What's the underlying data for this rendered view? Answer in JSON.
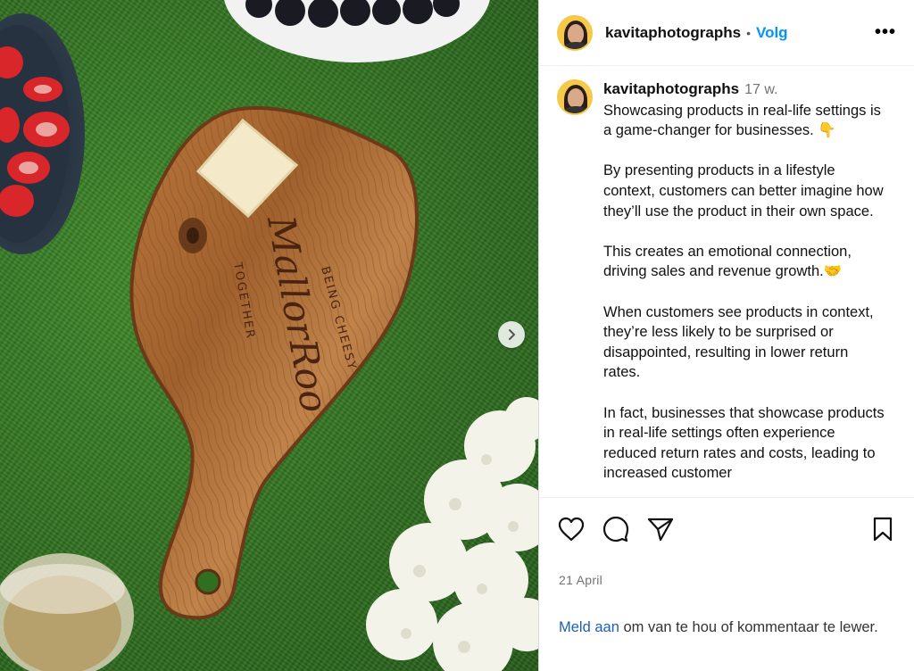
{
  "post": {
    "username": "kavitaphotographs",
    "separator": "•",
    "follow_label": "Volg",
    "more_label": "•••",
    "caption_username": "kavitaphotographs",
    "caption_time": "17 w.",
    "caption_text": "Showcasing products in real-life settings is a game-changer for businesses. 👇\n\nBy presenting products in a lifestyle context, customers can better imagine how they’ll use the product in their own space.\n\nThis creates an emotional connection, driving sales and revenue growth.🤝\n\nWhen customers see products in context, they’re less likely to be surprised or disappointed, resulting in lower return rates.\n\nIn fact, businesses that showcase products in real-life settings often experience reduced return rates and costs, leading to increased customer",
    "date": "21 April",
    "login_link": "Meld aan",
    "login_text": " om van te hou of kommentaar te lewer."
  },
  "photo": {
    "board_brand": "MallorRoo",
    "board_text_left": "TOGETHER",
    "board_text_right": "BEING CHEESY"
  },
  "icons": {
    "like": "heart-icon",
    "comment": "comment-icon",
    "share": "send-icon",
    "save": "bookmark-icon",
    "next": "chevron-right-icon"
  },
  "colors": {
    "follow": "#0095f6",
    "grass": "#2f6f1f",
    "wood": "#9a5a2a"
  }
}
